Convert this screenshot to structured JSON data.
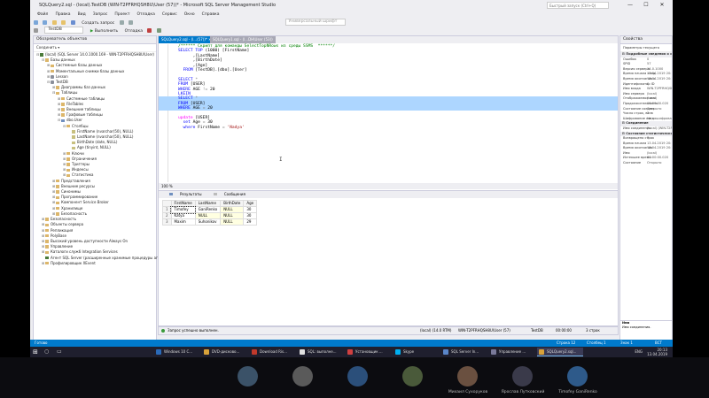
{
  "window": {
    "title": "SQLQuery2.sql - (local).TestDB (WIN-T2PFRHQSH8U\\User (57))* - Microsoft SQL Server Management Studio",
    "quick_launch_placeholder": "Быстрый запуск (Ctrl+Q)",
    "minimize": "—",
    "maximize": "☐",
    "close": "✕"
  },
  "menu": [
    "Файл",
    "Правка",
    "Вид",
    "Запрос",
    "Проект",
    "Отладка",
    "Сервис",
    "Окно",
    "Справка"
  ],
  "toolbar1": {
    "new_query": "Создать запрос",
    "dropdown": "Универсальный шрифт"
  },
  "toolbar2": {
    "database": "TestDB",
    "execute": "Выполнить",
    "debug": "Отладка"
  },
  "object_explorer": {
    "title": "Обозреватель объектов",
    "tools": "Соединить ▾",
    "items": [
      {
        "level": 0,
        "exp": "⊟",
        "icon": "srv",
        "label": "(local) (SQL Server 14.0.1000.169 - WIN-T2PFRHQSH8U\\User)"
      },
      {
        "level": 1,
        "exp": "⊟",
        "icon": "fold",
        "label": "Базы данных"
      },
      {
        "level": 2,
        "exp": "⊞",
        "icon": "fold",
        "label": "Системные базы данных"
      },
      {
        "level": 2,
        "exp": "⊞",
        "icon": "fold",
        "label": "Моментальные снимки базы данных"
      },
      {
        "level": 2,
        "exp": "⊞",
        "icon": "cyl",
        "label": "Lesson"
      },
      {
        "level": 2,
        "exp": "⊟",
        "icon": "cyl",
        "label": "TestDB"
      },
      {
        "level": 3,
        "exp": "⊞",
        "icon": "fold",
        "label": "Диаграммы баз данных"
      },
      {
        "level": 3,
        "exp": "⊟",
        "icon": "fold",
        "label": "Таблицы"
      },
      {
        "level": 4,
        "exp": "⊞",
        "icon": "fold",
        "label": "Системные таблицы"
      },
      {
        "level": 4,
        "exp": "⊞",
        "icon": "fold",
        "label": "FileTables"
      },
      {
        "level": 4,
        "exp": "⊞",
        "icon": "fold",
        "label": "Внешние таблицы"
      },
      {
        "level": 4,
        "exp": "⊞",
        "icon": "fold",
        "label": "Графовые таблицы"
      },
      {
        "level": 4,
        "exp": "⊟",
        "icon": "tbl",
        "label": "dbo.User"
      },
      {
        "level": 5,
        "exp": "⊟",
        "icon": "fold",
        "label": "Столбцы"
      },
      {
        "level": 6,
        "exp": "",
        "icon": "col",
        "label": "FirstName (nvarchar(50), NULL)"
      },
      {
        "level": 6,
        "exp": "",
        "icon": "col",
        "label": "LastName (nvarchar(50), NULL)"
      },
      {
        "level": 6,
        "exp": "",
        "icon": "col",
        "label": "BirthDate (date, NULL)"
      },
      {
        "level": 6,
        "exp": "",
        "icon": "col",
        "label": "Age (tinyint, NULL)"
      },
      {
        "level": 5,
        "exp": "⊞",
        "icon": "fold",
        "label": "Ключи"
      },
      {
        "level": 5,
        "exp": "⊞",
        "icon": "fold",
        "label": "Ограничения"
      },
      {
        "level": 5,
        "exp": "⊞",
        "icon": "fold",
        "label": "Триггеры"
      },
      {
        "level": 5,
        "exp": "⊞",
        "icon": "fold",
        "label": "Индексы"
      },
      {
        "level": 5,
        "exp": "⊞",
        "icon": "fold",
        "label": "Статистика"
      },
      {
        "level": 3,
        "exp": "⊞",
        "icon": "fold",
        "label": "Представления"
      },
      {
        "level": 3,
        "exp": "⊞",
        "icon": "fold",
        "label": "Внешние ресурсы"
      },
      {
        "level": 3,
        "exp": "⊞",
        "icon": "fold",
        "label": "Синонимы"
      },
      {
        "level": 3,
        "exp": "⊞",
        "icon": "fold",
        "label": "Программирование"
      },
      {
        "level": 3,
        "exp": "⊞",
        "icon": "fold",
        "label": "Компонент Service Broker"
      },
      {
        "level": 3,
        "exp": "⊞",
        "icon": "fold",
        "label": "Хранилище"
      },
      {
        "level": 3,
        "exp": "⊞",
        "icon": "fold",
        "label": "Безопасность"
      },
      {
        "level": 1,
        "exp": "⊞",
        "icon": "fold",
        "label": "Безопасность"
      },
      {
        "level": 1,
        "exp": "⊞",
        "icon": "fold",
        "label": "Объекты сервера"
      },
      {
        "level": 1,
        "exp": "⊞",
        "icon": "fold",
        "label": "Репликация"
      },
      {
        "level": 1,
        "exp": "⊞",
        "icon": "fold",
        "label": "PolyBase"
      },
      {
        "level": 1,
        "exp": "⊞",
        "icon": "fold",
        "label": "Высокий уровень доступности Always On"
      },
      {
        "level": 1,
        "exp": "⊞",
        "icon": "fold",
        "label": "Управление"
      },
      {
        "level": 1,
        "exp": "⊞",
        "icon": "fold",
        "label": "Каталоги служб Integration Services"
      },
      {
        "level": 1,
        "exp": "",
        "icon": "srv",
        "label": "Агент SQL Server (расширенные хранимые процедуры агента отключены)"
      },
      {
        "level": 1,
        "exp": "⊞",
        "icon": "fold",
        "label": "Профилировщик XEvent"
      }
    ]
  },
  "tabs": [
    {
      "label": "SQLQuery2.sql - (l...(57))* ✕",
      "active": true
    },
    {
      "label": "SQLQuery1.sql - (l...DH\\User (53))",
      "active": false
    }
  ],
  "editor": {
    "zoom": "100 %",
    "lines": [
      {
        "sel": false,
        "parts": [
          {
            "c": "cm",
            "t": "/****** Скрипт для команды SelectTopNRows из среды SSMS  ******/"
          }
        ]
      },
      {
        "sel": false,
        "parts": [
          {
            "c": "kw",
            "t": "SELECT TOP "
          },
          {
            "c": "",
            "t": "(1000) [FirstName]"
          }
        ]
      },
      {
        "sel": false,
        "parts": [
          {
            "c": "",
            "t": "      ,[LastName]"
          }
        ]
      },
      {
        "sel": false,
        "parts": [
          {
            "c": "",
            "t": "      ,[BirthDate]"
          }
        ]
      },
      {
        "sel": false,
        "parts": [
          {
            "c": "",
            "t": "      ,[Age]"
          }
        ]
      },
      {
        "sel": false,
        "parts": [
          {
            "c": "kw",
            "t": "  FROM "
          },
          {
            "c": "",
            "t": "[TestDB].[dbo].[User]"
          }
        ]
      },
      {
        "sel": false,
        "parts": [
          {
            "c": "",
            "t": ""
          }
        ]
      },
      {
        "sel": false,
        "parts": [
          {
            "c": "kw",
            "t": "SELECT "
          },
          {
            "c": "gy",
            "t": "*"
          }
        ]
      },
      {
        "sel": false,
        "parts": [
          {
            "c": "kw",
            "t": "FROM "
          },
          {
            "c": "",
            "t": "[USER]"
          }
        ]
      },
      {
        "sel": false,
        "parts": [
          {
            "c": "kw",
            "t": "WHERE "
          },
          {
            "c": "",
            "t": "AGE "
          },
          {
            "c": "gy",
            "t": "!= "
          },
          {
            "c": "",
            "t": "20"
          }
        ]
      },
      {
        "sel": false,
        "parts": [
          {
            "c": "kw",
            "t": "LKEIN"
          }
        ]
      },
      {
        "sel": true,
        "parts": [
          {
            "c": "kw",
            "t": "SELECT "
          },
          {
            "c": "gy",
            "t": "*"
          }
        ]
      },
      {
        "sel": true,
        "parts": [
          {
            "c": "kw",
            "t": "FROM "
          },
          {
            "c": "",
            "t": "[USER]"
          }
        ]
      },
      {
        "sel": true,
        "parts": [
          {
            "c": "kw",
            "t": "WHERE "
          },
          {
            "c": "",
            "t": "AGE "
          },
          {
            "c": "gy",
            "t": "= "
          },
          {
            "c": "",
            "t": "20"
          }
        ]
      },
      {
        "sel": false,
        "parts": [
          {
            "c": "",
            "t": ""
          }
        ]
      },
      {
        "sel": false,
        "parts": [
          {
            "c": "fn",
            "t": "update "
          },
          {
            "c": "",
            "t": "[USER]"
          }
        ]
      },
      {
        "sel": false,
        "parts": [
          {
            "c": "kw",
            "t": "  set "
          },
          {
            "c": "",
            "t": "Age "
          },
          {
            "c": "gy",
            "t": "= "
          },
          {
            "c": "",
            "t": "30"
          }
        ]
      },
      {
        "sel": false,
        "parts": [
          {
            "c": "kw",
            "t": "  where "
          },
          {
            "c": "",
            "t": "FirstName "
          },
          {
            "c": "gy",
            "t": "= "
          },
          {
            "c": "str",
            "t": "'Nadya'"
          }
        ]
      }
    ]
  },
  "results": {
    "tab_results": "Результаты",
    "tab_messages": "Сообщения",
    "columns": [
      "FirstName",
      "LastName",
      "BirthDate",
      "Age"
    ],
    "rows": [
      [
        "1",
        "Timofey",
        "GaniRenko",
        "NULL",
        "30"
      ],
      [
        "2",
        "Katya",
        "NULL",
        "NULL",
        "30"
      ],
      [
        "3",
        "Maxim",
        "Suhonikov",
        "NULL",
        "29"
      ]
    ]
  },
  "query_status": {
    "message": "Запрос успешно выполнен.",
    "server": "(local) (14.0 RTM)",
    "user": "WIN-T2PFRHQSH8U\\User (57)",
    "db": "TestDB",
    "time": "00:00:00",
    "rows": "3 строк"
  },
  "properties": {
    "title": "Свойства",
    "subtitle": "Параметры текущего соединения",
    "rows": [
      {
        "h": true,
        "k": "Подробные сведения о соединении",
        "v": ""
      },
      {
        "h": false,
        "k": "Ошибок",
        "v": "0"
      },
      {
        "h": false,
        "k": "SPID",
        "v": "57"
      },
      {
        "h": false,
        "k": "Версия сервера",
        "v": "14.0.1000"
      },
      {
        "h": false,
        "k": "Время начала соед",
        "v": "13.04.2019 20:13:40"
      },
      {
        "h": false,
        "k": "Время окончания с",
        "v": "13.04.2019 20:13:40"
      },
      {
        "h": false,
        "k": "Идентификатор ID",
        "v": "0"
      },
      {
        "h": false,
        "k": "Имя входа",
        "v": "WIN-T2PFRHQSH8U\\Use"
      },
      {
        "h": false,
        "k": "Имя сервера",
        "v": "(local)"
      },
      {
        "h": false,
        "k": "Отображаемое имя",
        "v": "(local)"
      },
      {
        "h": false,
        "k": "Продолжительность",
        "v": "00:00:00.020"
      },
      {
        "h": false,
        "k": "Состояние соедин",
        "v": "Открыто"
      },
      {
        "h": false,
        "k": "Число строк, возв",
        "v": "3"
      },
      {
        "h": false,
        "k": "Шифрование соед",
        "v": "Не зашифровано"
      },
      {
        "h": true,
        "k": "Соединение",
        "v": ""
      },
      {
        "h": false,
        "k": "Имя соединения",
        "v": "(local) (WIN-T2PFRHQSH8U"
      },
      {
        "h": true,
        "k": "Состояние статистического вычисле",
        "v": ""
      },
      {
        "h": false,
        "k": "Возвращено строк",
        "v": "3"
      },
      {
        "h": false,
        "k": "Время начала",
        "v": "13.04.2019 20:13:40"
      },
      {
        "h": false,
        "k": "Время окончания",
        "v": "13.04.2019 20:13:40"
      },
      {
        "h": false,
        "k": "Имя",
        "v": "(local)"
      },
      {
        "h": false,
        "k": "Истекшее время",
        "v": "00:00:00.020"
      },
      {
        "h": false,
        "k": "Состояние",
        "v": "Открыто"
      }
    ],
    "desc_title": "Имя",
    "desc_text": "Имя соединения."
  },
  "statusbar": {
    "ready": "Готово",
    "row": "Строка 12",
    "col": "Столбец 1",
    "char": "Знак 1",
    "mode": "ВСТ"
  },
  "taskbar": {
    "items": [
      {
        "label": "Windows 10 С...",
        "color": "#2a6ab8",
        "active": false
      },
      {
        "label": "DVD-дисково...",
        "color": "#d8a23a",
        "active": false
      },
      {
        "label": "Download Ris...",
        "color": "#c0392b",
        "active": false
      },
      {
        "label": "SQL: выполне...",
        "color": "#e0e0e0",
        "active": false
      },
      {
        "label": "Установщик ...",
        "color": "#d04040",
        "active": false
      },
      {
        "label": "Skype",
        "color": "#00aff0",
        "active": false
      },
      {
        "label": "SQL Server In...",
        "color": "#5a86c8",
        "active": false
      },
      {
        "label": "Управление ...",
        "color": "#7a7a9a",
        "active": false
      },
      {
        "label": "SQLQuery2.sql...",
        "color": "#d8a23a",
        "active": true
      }
    ],
    "lang": "ENG",
    "time": "20:13",
    "date": "13.04.2019"
  },
  "participants": [
    {
      "name": "",
      "color": "#3b5268"
    },
    {
      "name": "",
      "color": "#5a5a5a"
    },
    {
      "name": "",
      "color": "#2b4f7a"
    },
    {
      "name": "",
      "color": "#4a5a3a"
    },
    {
      "name": "Михаил Сухоруков",
      "color": "#6a5040"
    },
    {
      "name": "Ярослав Лутковский",
      "color": "#3a3a4a"
    },
    {
      "name": "Timofey GaniRenko",
      "color": "#2e5a8a"
    }
  ]
}
